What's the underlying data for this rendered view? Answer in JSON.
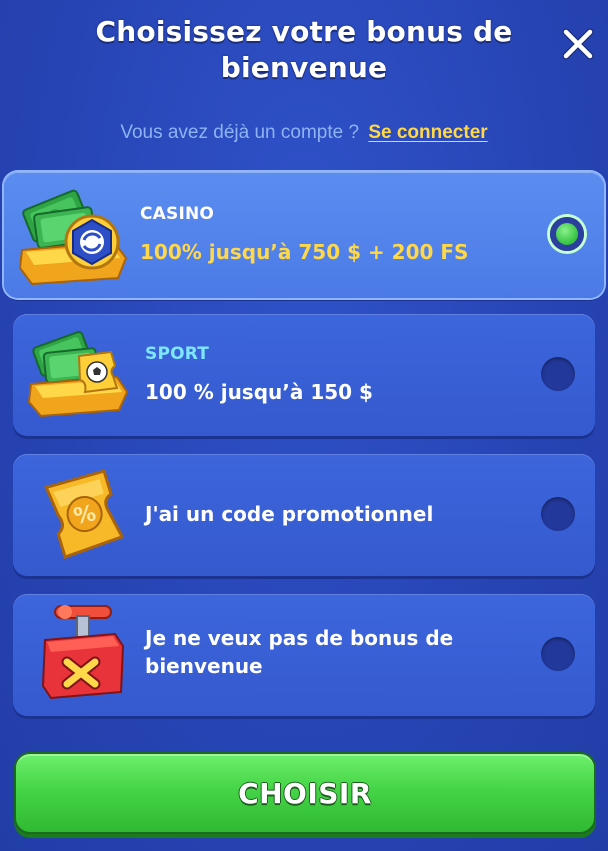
{
  "modal": {
    "title": "Choisissez votre bonus de bienvenue",
    "close_icon": "close-icon"
  },
  "login": {
    "prompt": "Vous avez déjà un compte ?",
    "link": "Se connecter"
  },
  "options": [
    {
      "icon": "casino-money-chest-icon",
      "label": "CASINO",
      "text": "100% jusqu’à 750 $ + 200 FS",
      "selected": true
    },
    {
      "icon": "sport-money-chest-icon",
      "label": "SPORT",
      "text": "100 % jusqu’à 150 $",
      "selected": false
    },
    {
      "icon": "promo-ticket-icon",
      "text": "J'ai un code promotionnel",
      "selected": false
    },
    {
      "icon": "no-bonus-detonator-icon",
      "text": "Je ne veux pas de bonus de bienvenue",
      "selected": false
    }
  ],
  "actions": {
    "choose_label": "CHOISIR"
  },
  "colors": {
    "background": "#2a48b8",
    "card": "#3559cf",
    "card_selected": "#4b7ae6",
    "highlight_text": "#ffd84a",
    "sport_label": "#7fe6ff",
    "link": "#ffd84a",
    "button_green": "#45d447"
  }
}
